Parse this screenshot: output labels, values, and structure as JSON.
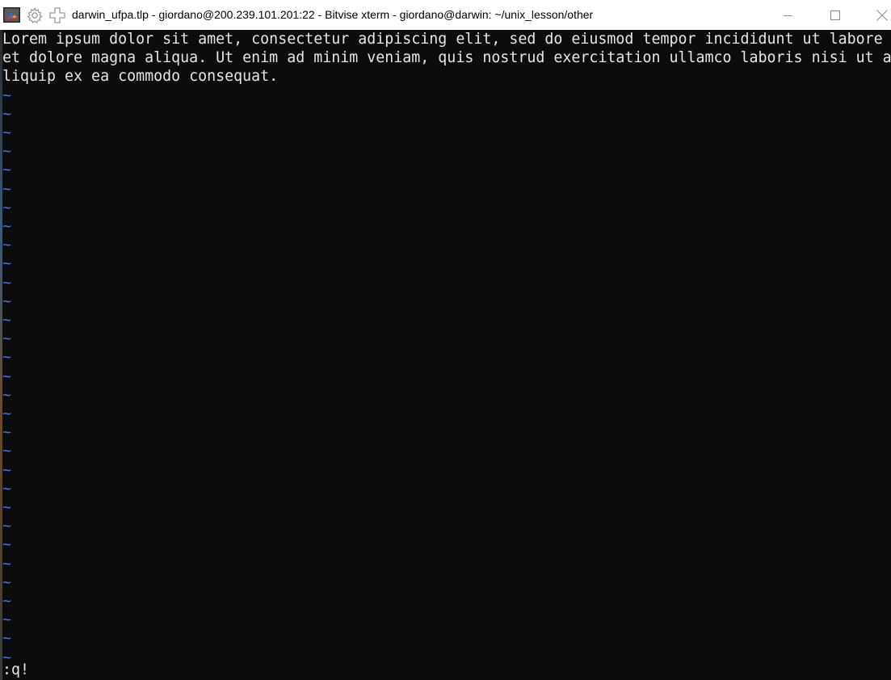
{
  "window": {
    "title": "darwin_ufpa.tlp - giordano@200.239.101.201:22 - Bitvise xterm - giordano@darwin: ~/unix_lesson/other"
  },
  "titlebar_icons": [
    "bitvise-app-icon",
    "gear-icon",
    "plus-icon"
  ],
  "window_controls": [
    "minimize-icon",
    "maximize-icon",
    "close-icon"
  ],
  "colors": {
    "terminal_background": "#0c0c0c",
    "text": "#e6e6e6",
    "tilde": "#3f6fe0"
  },
  "terminal": {
    "lines": [
      "Lorem ipsum dolor sit amet, consectetur adipiscing elit, sed do eiusmod tempor incididunt ut labore",
      "et dolore magna aliqua. Ut enim ad minim veniam, quis nostrud exercitation ullamco laboris nisi ut a",
      "liquip ex ea commodo consequat."
    ],
    "empty_line_marker": "~",
    "empty_line_count": 31,
    "command_line": ":q!"
  }
}
